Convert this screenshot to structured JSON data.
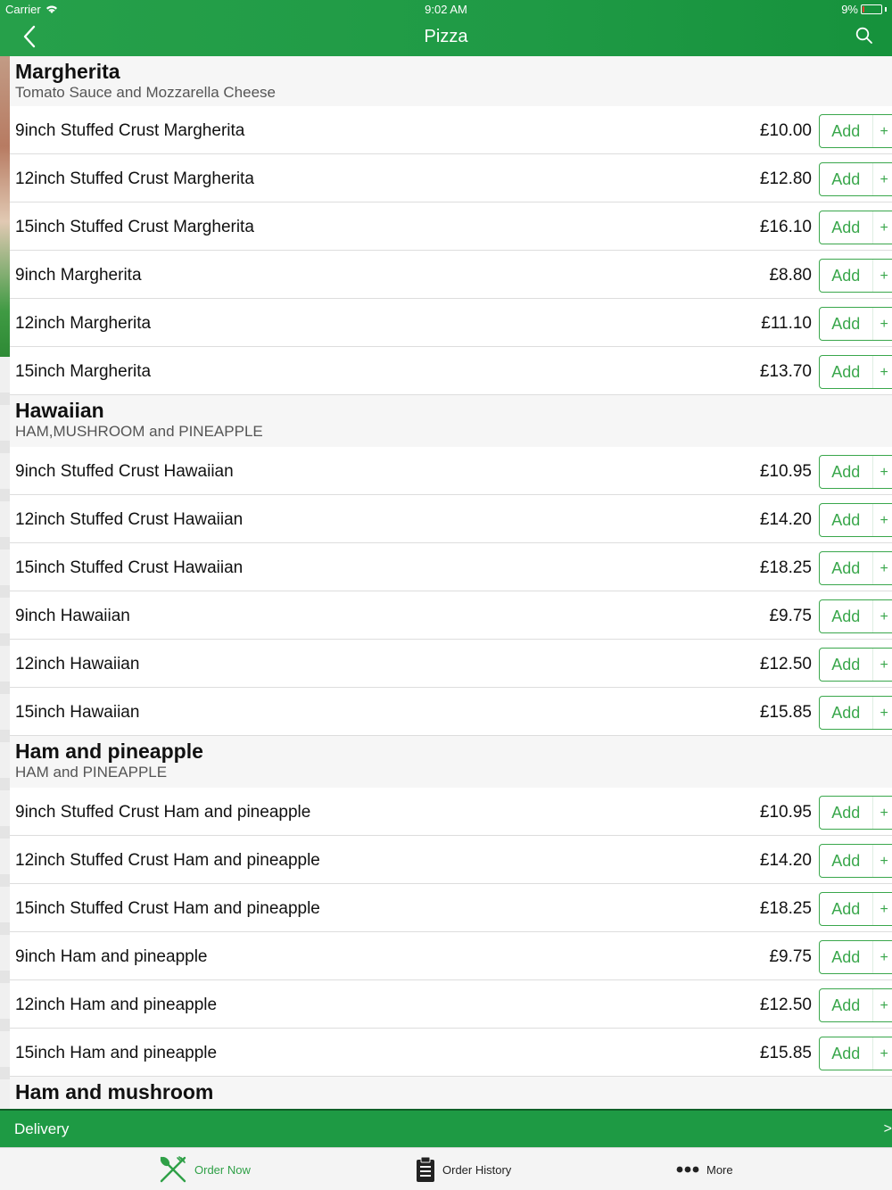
{
  "status_bar": {
    "carrier": "Carrier",
    "time": "9:02 AM",
    "battery": "9%",
    "battery_level": 0.09
  },
  "header": {
    "title": "Pizza"
  },
  "sections": [
    {
      "name": "Margherita",
      "description": "Tomato Sauce and Mozzarella Cheese",
      "items": [
        {
          "label": "9inch Stuffed Crust Margherita",
          "price": "£10.00"
        },
        {
          "label": "12inch Stuffed Crust Margherita",
          "price": "£12.80"
        },
        {
          "label": "15inch Stuffed Crust Margherita",
          "price": "£16.10"
        },
        {
          "label": "9inch Margherita",
          "price": "£8.80"
        },
        {
          "label": "12inch Margherita",
          "price": "£11.10"
        },
        {
          "label": "15inch Margherita",
          "price": "£13.70"
        }
      ]
    },
    {
      "name": "Hawaiian",
      "description": "HAM,MUSHROOM and PINEAPPLE",
      "items": [
        {
          "label": "9inch Stuffed Crust Hawaiian",
          "price": "£10.95"
        },
        {
          "label": "12inch Stuffed Crust Hawaiian",
          "price": "£14.20"
        },
        {
          "label": "15inch Stuffed Crust Hawaiian",
          "price": "£18.25"
        },
        {
          "label": "9inch Hawaiian",
          "price": "£9.75"
        },
        {
          "label": "12inch Hawaiian",
          "price": "£12.50"
        },
        {
          "label": "15inch Hawaiian",
          "price": "£15.85"
        }
      ]
    },
    {
      "name": "Ham and pineapple",
      "description": "HAM and PINEAPPLE",
      "items": [
        {
          "label": "9inch Stuffed Crust Ham and pineapple",
          "price": "£10.95"
        },
        {
          "label": "12inch Stuffed Crust Ham and pineapple",
          "price": "£14.20"
        },
        {
          "label": "15inch Stuffed Crust Ham and pineapple",
          "price": "£18.25"
        },
        {
          "label": "9inch Ham and pineapple",
          "price": "£9.75"
        },
        {
          "label": "12inch Ham and pineapple",
          "price": "£12.50"
        },
        {
          "label": "15inch Ham and pineapple",
          "price": "£15.85"
        }
      ]
    },
    {
      "name": "Ham and mushroom",
      "description": "",
      "items": []
    }
  ],
  "buttons": {
    "add_label": "Add",
    "plus_label": "+"
  },
  "delivery": {
    "label": "Delivery",
    "chevron": ">"
  },
  "tabbar": {
    "order_now": "Order Now",
    "order_history": "Order History",
    "more": "More"
  },
  "colors": {
    "brand_green": "#1f9a45",
    "accent_green": "#3aa74c",
    "battery_low": "#ff3b30"
  },
  "icons": {
    "back": "chevron-left-icon",
    "search": "search-icon",
    "order_now": "fork-knife-icon",
    "order_history": "clipboard-icon",
    "more": "ellipsis-icon",
    "wifi": "wifi-icon",
    "battery": "battery-icon"
  }
}
